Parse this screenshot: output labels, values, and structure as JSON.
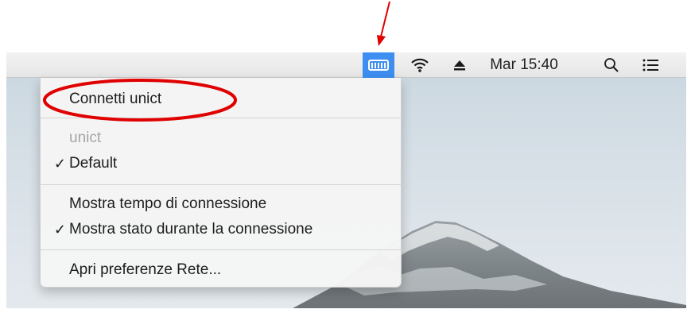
{
  "menubar": {
    "vpn_icon": "vpn-icon",
    "wifi_icon": "wifi-icon",
    "eject_icon": "eject-icon",
    "clock": "Mar 15:40",
    "search_icon": "search-icon",
    "list_icon": "notification-list-icon",
    "vpn_active_color": "#3d8ef0"
  },
  "menu": {
    "connect": "Connetti unict",
    "section_header": "unict",
    "default": "Default",
    "default_checked": "✓",
    "show_time": "Mostra tempo di connessione",
    "show_status": "Mostra stato durante la connessione",
    "show_status_checked": "✓",
    "open_prefs": "Apri preferenze Rete..."
  },
  "annotation": {
    "highlight_color": "#e00000"
  }
}
